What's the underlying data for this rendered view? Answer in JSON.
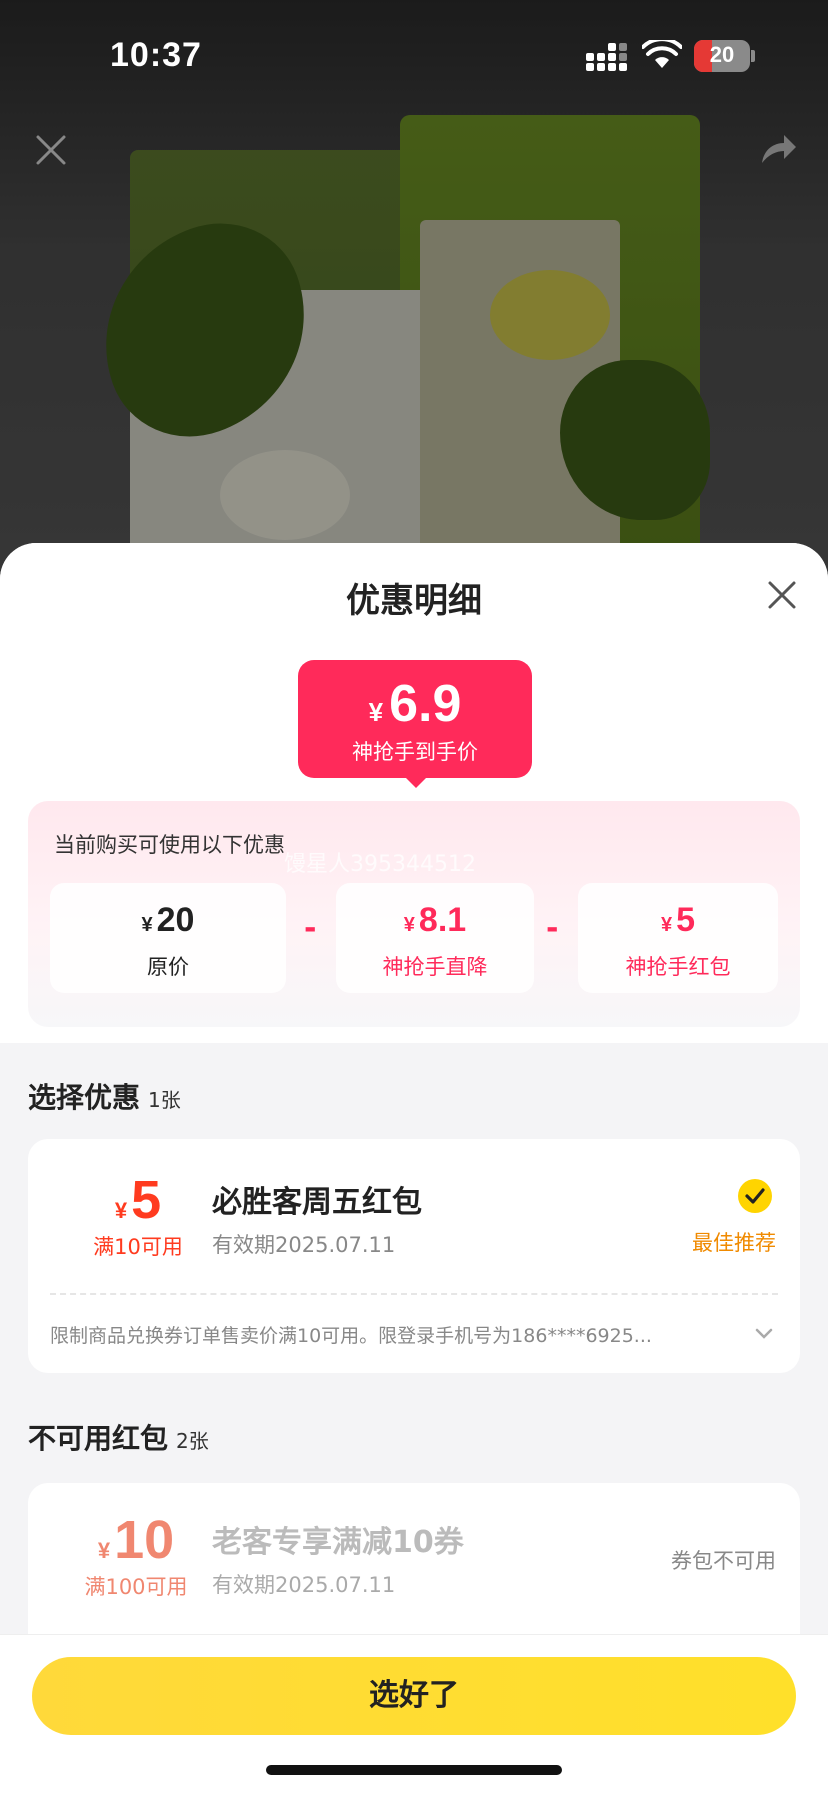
{
  "status_bar": {
    "time": "10:37",
    "battery": "20"
  },
  "sheet": {
    "title": "优惠明细",
    "final_price": {
      "currency": "¥",
      "amount": "6.9",
      "label": "神抢手到手价"
    },
    "breakdown": {
      "hint": "当前购买可使用以下优惠",
      "watermark": "馒星人395344512",
      "items": [
        {
          "currency": "¥",
          "amount": "20",
          "label": "原价"
        },
        {
          "currency": "¥",
          "amount": "8.1",
          "label": "神抢手直降"
        },
        {
          "currency": "¥",
          "amount": "5",
          "label": "神抢手红包"
        }
      ],
      "operator": "-"
    },
    "select_section": {
      "title": "选择优惠",
      "count": "1张"
    },
    "selected_coupon": {
      "currency": "¥",
      "amount": "5",
      "condition": "满10可用",
      "name": "必胜客周五红包",
      "validity": "有效期2025.07.11",
      "tag": "最佳推荐",
      "description": "限制商品兑换券订单售卖价满10可用。限登录手机号为186****6925..."
    },
    "unavailable_section": {
      "title": "不可用红包",
      "count": "2张"
    },
    "unavailable_coupon": {
      "currency": "¥",
      "amount": "10",
      "condition": "满100可用",
      "name": "老客专享满减10券",
      "validity": "有效期2025.07.11",
      "status": "券包不可用"
    },
    "confirm_label": "选好了"
  },
  "colors": {
    "accent_pink": "#ff2a5a",
    "coupon_red": "#ff3b1f",
    "best_orange": "#f08a00",
    "button_yellow": "#ffdd33"
  }
}
